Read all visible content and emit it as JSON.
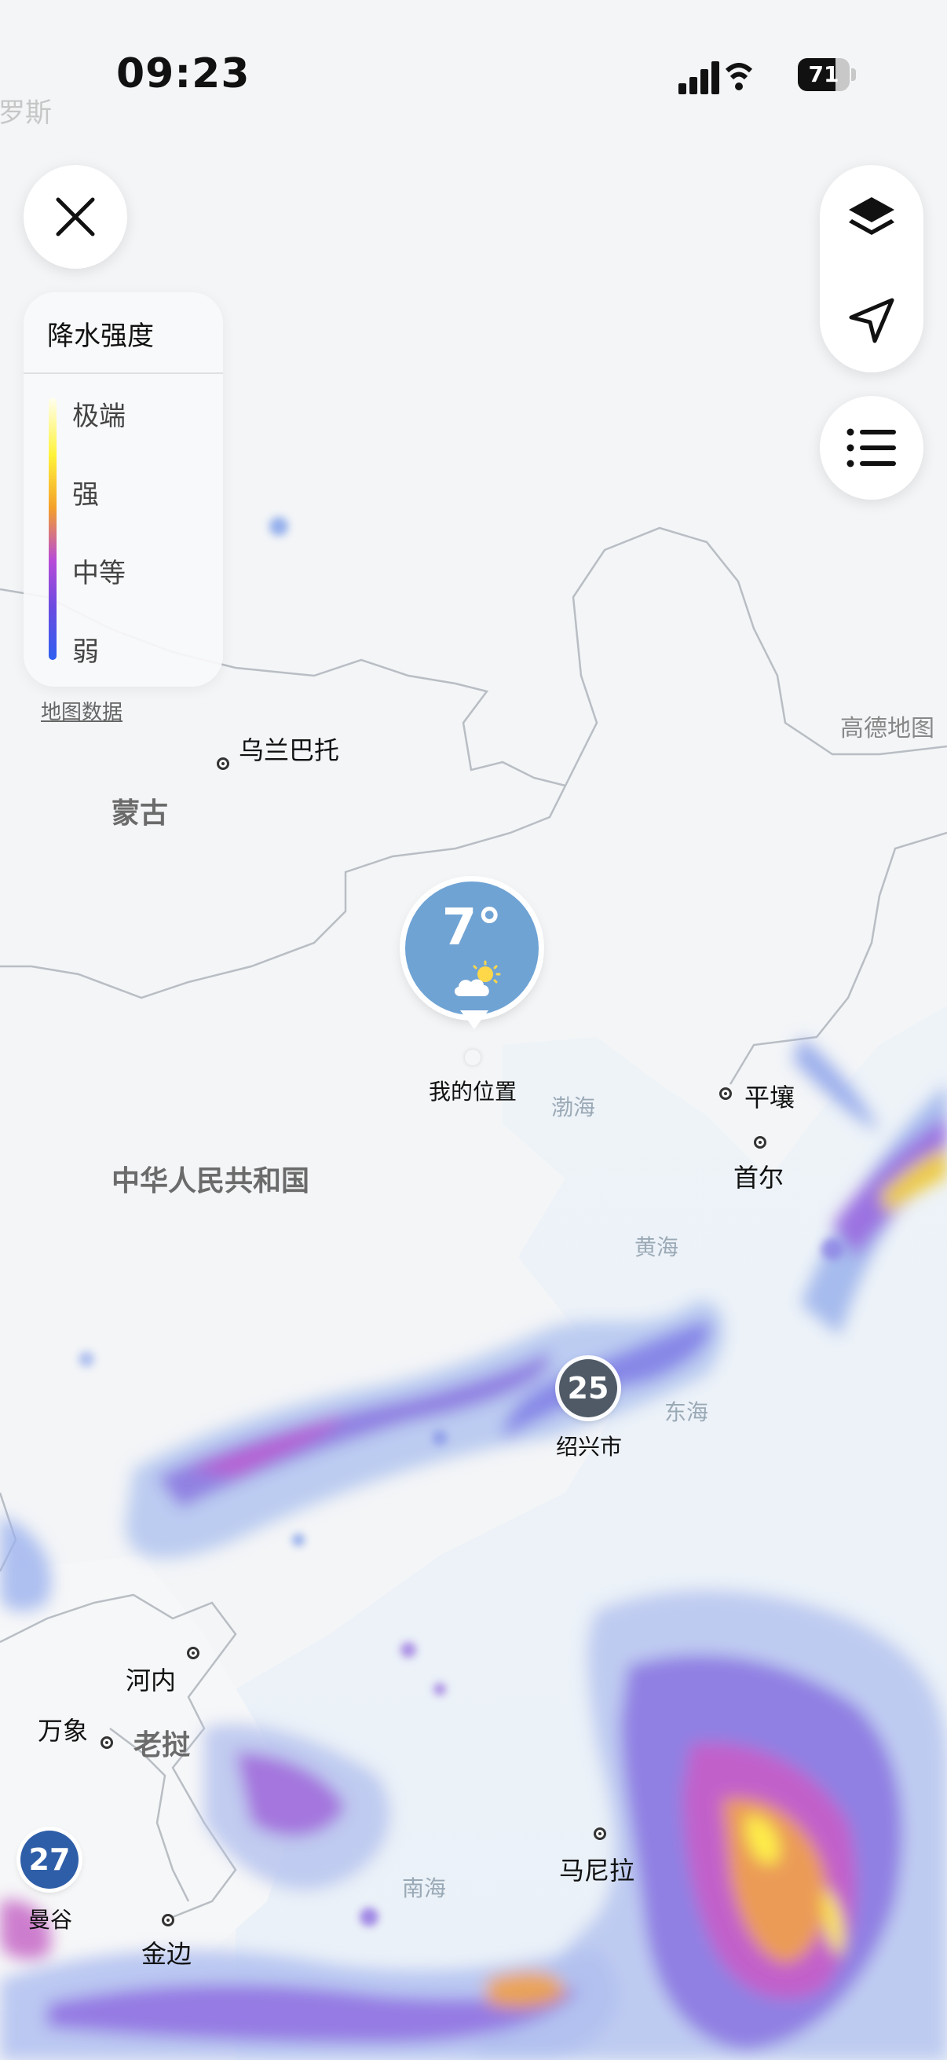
{
  "status_bar": {
    "time": "09:23",
    "battery": "71"
  },
  "legend": {
    "title": "降水强度",
    "levels": [
      "极端",
      "强",
      "中等",
      "弱"
    ]
  },
  "attribution": "地图数据",
  "provider": "高德地图",
  "icons": {
    "close": "close-icon",
    "layers": "layers-icon",
    "location": "location-arrow-icon",
    "list": "list-icon"
  },
  "my_location": {
    "temperature": "7°",
    "label": "我的位置",
    "condition_icon": "partly-cloudy-icon"
  },
  "cities": {
    "ulaanbaatar": "乌兰巴托",
    "pyongyang": "平壤",
    "seoul": "首尔",
    "shaoxing": "绍兴市",
    "hanoi": "河内",
    "vientiane": "万象",
    "manila": "马尼拉",
    "bangkok": "曼谷",
    "phnompenh": "金边"
  },
  "countries": {
    "mongolia": "蒙古",
    "china": "中华人民共和国",
    "laos": "老挝",
    "russia": "俄罗斯"
  },
  "seas": {
    "bohai": "渤海",
    "yellow": "黄海",
    "east": "东海",
    "south": "南海"
  },
  "badges": {
    "shaoxing_temp": "25",
    "bangkok_temp": "27"
  },
  "colors": {
    "pin": "#6fa3d4",
    "badge_gray": "#4f5a66",
    "badge_blue": "#2f5ea8"
  }
}
